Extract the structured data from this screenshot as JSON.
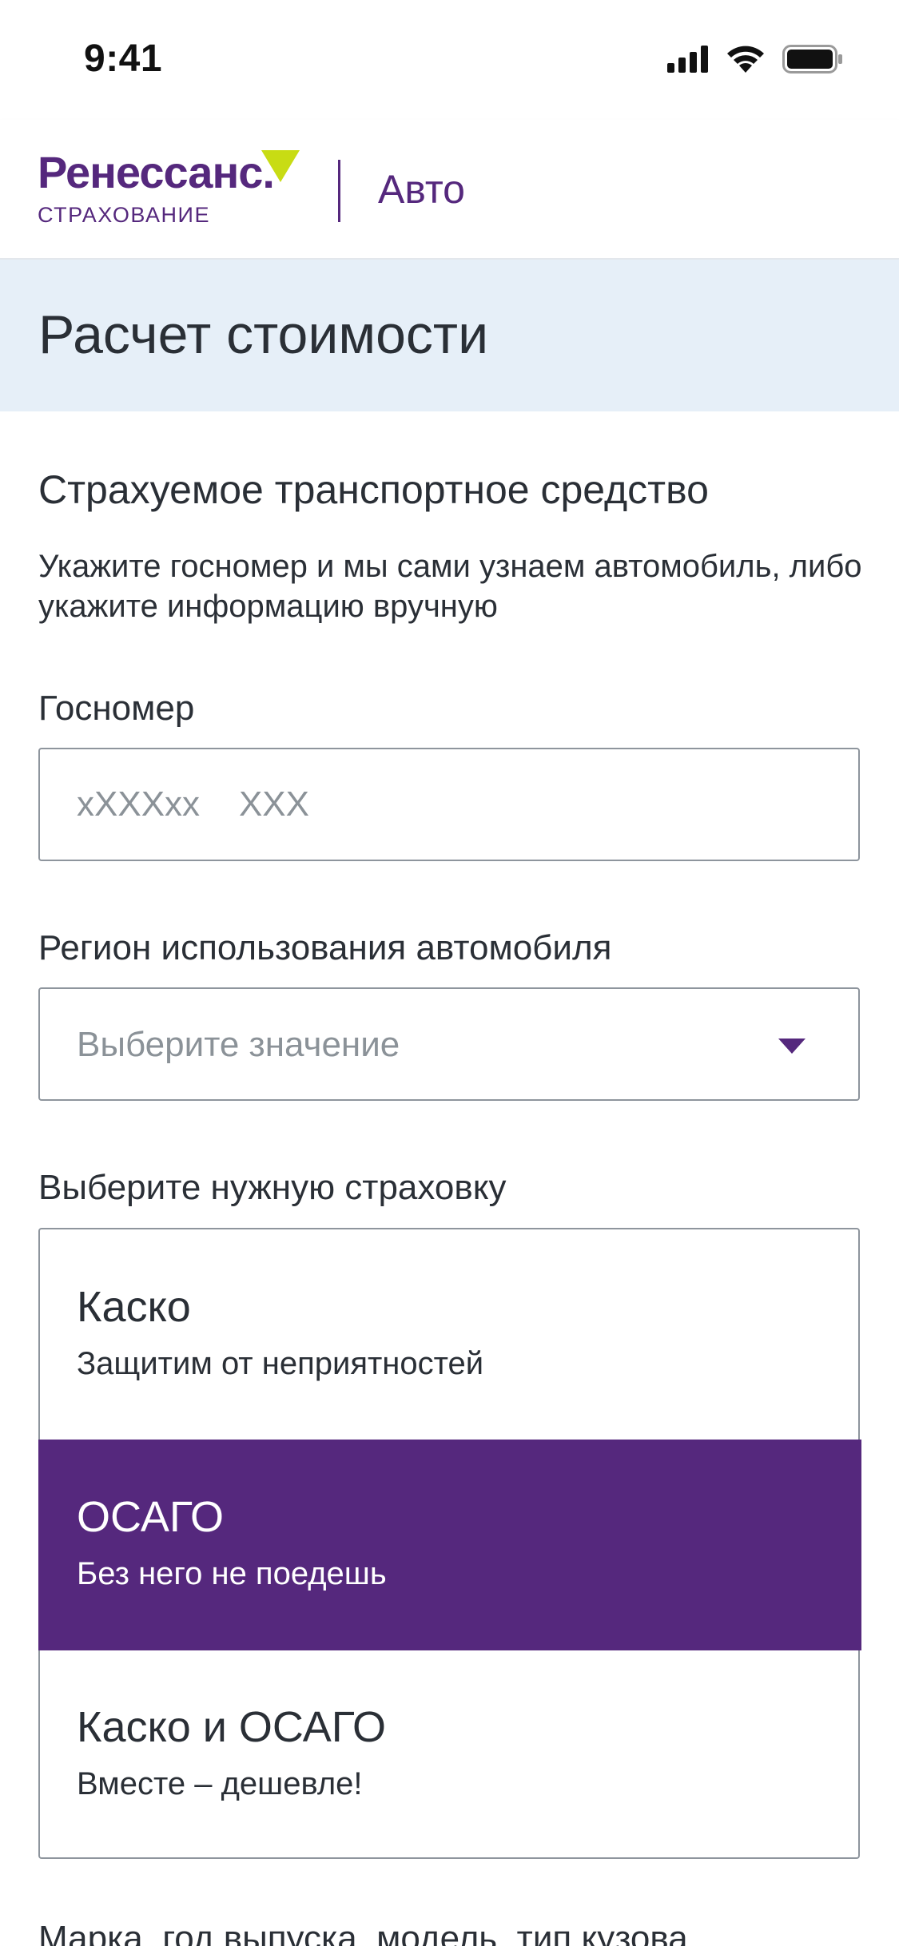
{
  "status_bar": {
    "time": "9:41",
    "icons": [
      "cellular-signal-icon",
      "wifi-icon",
      "battery-icon"
    ]
  },
  "header": {
    "logo_main": "Ренессанс.",
    "logo_sub": "СТРАХОВАНИЕ",
    "section": "Авто"
  },
  "page": {
    "title": "Расчет стоимости"
  },
  "vehicle": {
    "title": "Страхуемое транспортное средство",
    "description": "Укажите госномер и мы сами узнаем автомобиль, либо укажите информацию вручную"
  },
  "plate": {
    "label": "Госномер",
    "placeholder": "xXXXxx    XXX",
    "value": ""
  },
  "region": {
    "label": "Регион  использования автомобиля",
    "placeholder": "Выберите значение"
  },
  "insurance": {
    "label": "Выберите нужную страховку",
    "options": [
      {
        "title": "Каско",
        "subtitle": "Защитим от неприятностей",
        "selected": false
      },
      {
        "title": "ОСАГО",
        "subtitle": "Без него не поедешь",
        "selected": true
      },
      {
        "title": "Каско и ОСАГО",
        "subtitle": "Вместе – дешевле!",
        "selected": false
      }
    ]
  },
  "next_section": {
    "label": "Марка, год выпуска, модель, тип кузова"
  },
  "colors": {
    "brand_purple": "#55287d",
    "brand_lime": "#c8dc14",
    "title_band": "#e6eff8",
    "text": "#2a2f36",
    "placeholder": "#8b9298"
  }
}
